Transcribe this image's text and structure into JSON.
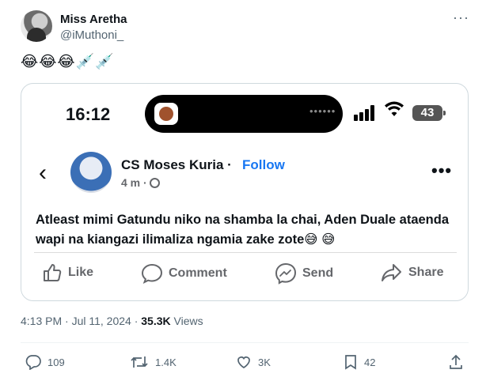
{
  "author": {
    "name": "Miss Aretha",
    "apple_glyph": "",
    "handle": "@iMuthoni_",
    "more": "···"
  },
  "tweet_text": "😂😂😂💉💉",
  "screenshot": {
    "status_bar": {
      "time": "16:12",
      "battery": "43",
      "island_dots": "••••••"
    },
    "post": {
      "back": "‹",
      "author_name": "CS Moses Kuria",
      "separator": "·",
      "follow_label": "Follow",
      "time_ago": "4 m ·",
      "more": "•••",
      "text": "Atleast mimi Gatundu niko na shamba la chai, Aden Duale ataenda wapi na kiangazi ilimaliza ngamia zake zote😅 😅"
    },
    "actions": [
      {
        "label": "Like",
        "icon": "thumbs-up-icon"
      },
      {
        "label": "Comment",
        "icon": "comment-icon"
      },
      {
        "label": "Send",
        "icon": "messenger-icon"
      },
      {
        "label": "Share",
        "icon": "share-icon"
      }
    ]
  },
  "timestamp": {
    "time": "4:13 PM · Jul 11, 2024 · ",
    "views_count": "35.3K",
    "views_label": " Views"
  },
  "engagement": {
    "replies": "109",
    "retweets": "1.4K",
    "likes": "3K",
    "bookmarks": "42"
  },
  "colors": {
    "facebook_blue": "#1877f2",
    "secondary_text": "#536471"
  }
}
